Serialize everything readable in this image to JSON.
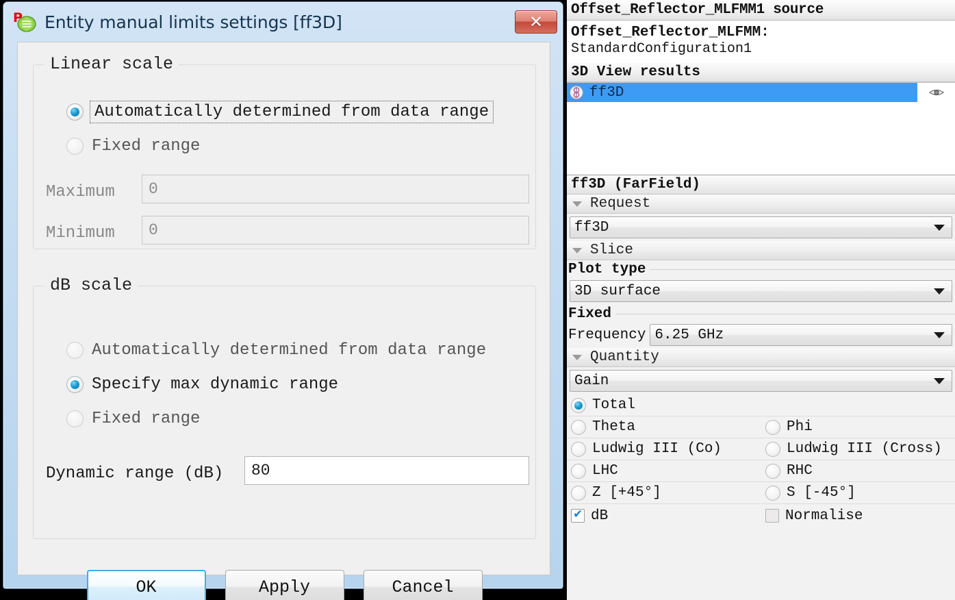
{
  "dialog": {
    "title": "Entity manual limits settings [ff3D]",
    "logo_icon": "postfeko-logo-icon",
    "close_label": "✕",
    "linear_scale": {
      "legend": "Linear scale",
      "options": [
        {
          "label": "Automatically determined from data range",
          "checked": true,
          "focused": true,
          "disabled": false
        },
        {
          "label": "Fixed range",
          "checked": false,
          "focused": false,
          "disabled": true
        }
      ],
      "maximum_label": "Maximum",
      "maximum_value": "0",
      "minimum_label": "Minimum",
      "minimum_value": "0",
      "fields_disabled": true
    },
    "db_scale": {
      "legend": "dB scale",
      "options": [
        {
          "label": "Automatically determined from data range",
          "checked": false,
          "disabled": true
        },
        {
          "label": "Specify max dynamic range",
          "checked": true,
          "disabled": false
        },
        {
          "label": "Fixed range",
          "checked": false,
          "disabled": true
        }
      ],
      "dynamic_range_label": "Dynamic range (dB)",
      "dynamic_range_value": "80"
    },
    "buttons": {
      "ok": "OK",
      "apply": "Apply",
      "cancel": "Cancel"
    }
  },
  "panel": {
    "header": "Offset_Reflector_MLFMM1 source",
    "source_line1": "Offset_Reflector_MLFMM:",
    "source_line2": "StandardConfiguration1",
    "results_header": "3D View results",
    "result_items": [
      {
        "label": "ff3D",
        "selected": true,
        "icon": "farfield-icon",
        "eye_icon": "eye-icon"
      }
    ],
    "entity_header": "ff3D (FarField)",
    "sections": {
      "request": {
        "title": "Request",
        "combo_value": "ff3D"
      },
      "slice": {
        "title": "Slice",
        "plot_type_label": "Plot type",
        "plot_type_value": "3D surface",
        "fixed_label": "Fixed",
        "frequency_label": "Frequency",
        "frequency_value": "6.25 GHz"
      },
      "quantity": {
        "title": "Quantity",
        "combo_value": "Gain",
        "radios": [
          {
            "label": "Total",
            "checked": true,
            "full_width": true
          },
          {
            "label": "Theta",
            "checked": false
          },
          {
            "label": "Phi",
            "checked": false
          },
          {
            "label": "Ludwig III (Co)",
            "checked": false
          },
          {
            "label": "Ludwig III (Cross)",
            "checked": false
          },
          {
            "label": "LHC",
            "checked": false
          },
          {
            "label": "RHC",
            "checked": false
          },
          {
            "label": "Z [+45°]",
            "checked": false
          },
          {
            "label": "S [-45°]",
            "checked": false
          }
        ],
        "checkboxes": [
          {
            "label": "dB",
            "checked": true
          },
          {
            "label": "Normalise",
            "checked": false
          }
        ]
      }
    }
  },
  "colors": {
    "selection_blue": "#3d9bf5",
    "accent_blue": "#1a9fd4",
    "close_red": "#c6483a",
    "window_frame": "#c3dcf2"
  }
}
